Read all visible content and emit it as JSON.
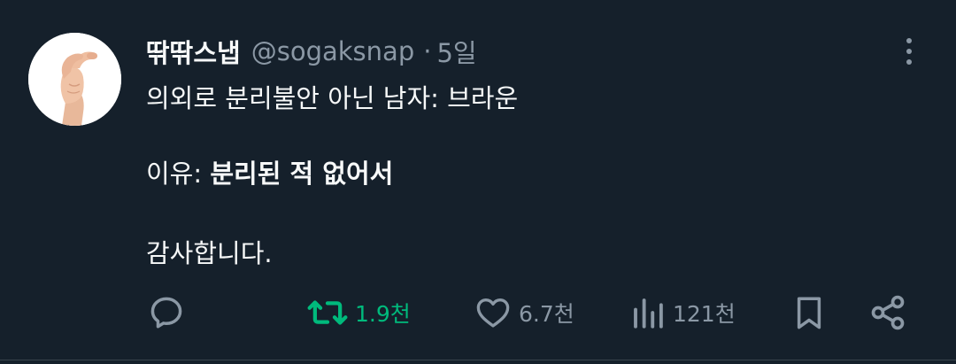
{
  "tweet": {
    "display_name": "딲딲스냅",
    "handle": "@sogaksnap",
    "separator": "·",
    "time": "5일",
    "line1": "의외로 분리불안 아닌 남자: 브라운",
    "line2_prefix": "이유: ",
    "line2_bold": "분리된 적 없어서",
    "line3": "감사합니다."
  },
  "actions": {
    "reply_count": "",
    "retweet_count": "1.9천",
    "like_count": "6.7천",
    "views_count": "121천"
  },
  "colors": {
    "background": "#15202b",
    "text_primary": "#f7f9f9",
    "text_secondary": "#8b98a5",
    "retweeted": "#00ba7c"
  },
  "icons": {
    "avatar": "hand-pinch-avatar",
    "more": "more-vertical-icon",
    "reply": "reply-bubble-icon",
    "retweet": "retweet-icon",
    "like": "heart-icon",
    "views": "views-bar-chart-icon",
    "bookmark": "bookmark-icon",
    "share": "share-icon"
  }
}
